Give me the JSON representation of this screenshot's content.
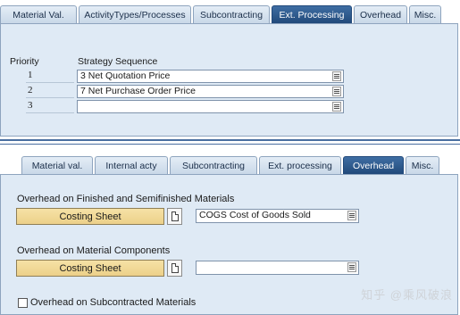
{
  "top": {
    "tabs": [
      {
        "label": "Material Val.",
        "active": false
      },
      {
        "label": "ActivityTypes/Processes",
        "active": false
      },
      {
        "label": "Subcontracting",
        "active": false
      },
      {
        "label": "Ext. Processing",
        "active": true
      },
      {
        "label": "Overhead",
        "active": false
      },
      {
        "label": "Misc.",
        "active": false
      }
    ],
    "priority_header": "Priority",
    "strategy_header": "Strategy Sequence",
    "rows": [
      {
        "priority": "1",
        "strategy": "3 Net Quotation Price"
      },
      {
        "priority": "2",
        "strategy": "7 Net Purchase Order Price"
      },
      {
        "priority": "3",
        "strategy": ""
      }
    ]
  },
  "bottom": {
    "tabs": [
      {
        "label": "Material val.",
        "active": false
      },
      {
        "label": "Internal acty",
        "active": false
      },
      {
        "label": "Subcontracting",
        "active": false
      },
      {
        "label": "Ext. processing",
        "active": false
      },
      {
        "label": "Overhead",
        "active": true
      },
      {
        "label": "Misc.",
        "active": false
      }
    ],
    "finished": {
      "title": "Overhead on Finished and Semifinished Materials",
      "button_label": "Costing Sheet",
      "value": "COGS Cost of Goods Sold"
    },
    "components": {
      "title": "Overhead on Material Components",
      "button_label": "Costing Sheet",
      "value": ""
    },
    "subcontracted_label": "Overhead on Subcontracted Materials",
    "subcontracted_checked": false
  },
  "watermark": "知乎 @乘风破浪",
  "colors": {
    "active_tab": "#2f5a8c",
    "panel_bg": "#dfeaf5",
    "costing_button": "#efd594"
  }
}
